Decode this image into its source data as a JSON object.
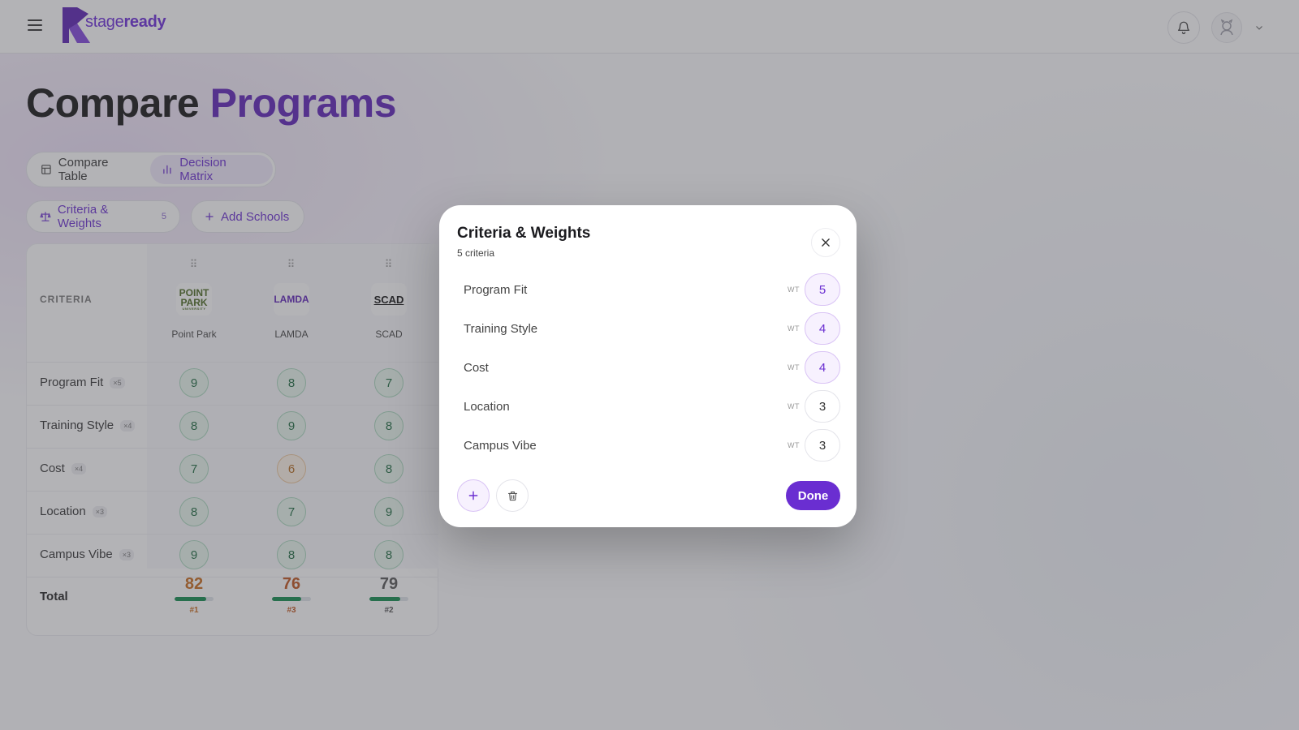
{
  "header": {
    "logo_text_thin": "stage",
    "logo_text_bold": "ready",
    "icons": [
      "menu-icon",
      "bell-icon",
      "avatar-icon",
      "chevron-down-icon"
    ]
  },
  "page": {
    "title_main": "Compare",
    "title_accent": "Programs"
  },
  "view_toggle": {
    "compare_table": "Compare Table",
    "decision_matrix": "Decision Matrix",
    "active": "Decision Matrix"
  },
  "toolbar": {
    "criteria_label": "Criteria & Weights",
    "criteria_count": "5",
    "add_schools_label": "Add Schools"
  },
  "matrix": {
    "header_label": "CRITERIA",
    "schools": [
      {
        "name": "Point Park",
        "logo_line1": "POINT",
        "logo_line2": "PARK",
        "logo_line3": "UNIVERSITY"
      },
      {
        "name": "LAMDA",
        "logo_text": "LAMDA"
      },
      {
        "name": "SCAD",
        "logo_text": "SCAD"
      }
    ],
    "rows": [
      {
        "label": "Program Fit",
        "weight": "×5",
        "scores": [
          "9",
          "8",
          "7"
        ]
      },
      {
        "label": "Training Style",
        "weight": "×4",
        "scores": [
          "8",
          "9",
          "8"
        ]
      },
      {
        "label": "Cost",
        "weight": "×4",
        "scores": [
          "7",
          "6",
          "8"
        ]
      },
      {
        "label": "Location",
        "weight": "×3",
        "scores": [
          "8",
          "7",
          "9"
        ]
      },
      {
        "label": "Campus Vibe",
        "weight": "×3",
        "scores": [
          "9",
          "8",
          "8"
        ]
      }
    ],
    "total_label": "Total",
    "totals": [
      {
        "value": "82",
        "rank": "#1",
        "fill": 0.82,
        "color": "#c86a1a"
      },
      {
        "value": "76",
        "rank": "#3",
        "fill": 0.76,
        "color": "#c0541c"
      },
      {
        "value": "79",
        "rank": "#2",
        "fill": 0.79,
        "color": "#555555"
      }
    ]
  },
  "modal": {
    "title": "Criteria & Weights",
    "subtitle": "5 criteria",
    "wt_label": "WT",
    "criteria": [
      {
        "name": "Program Fit",
        "weight": "5"
      },
      {
        "name": "Training Style",
        "weight": "4"
      },
      {
        "name": "Cost",
        "weight": "4"
      },
      {
        "name": "Location",
        "weight": "3"
      },
      {
        "name": "Campus Vibe",
        "weight": "3"
      }
    ],
    "done_label": "Done"
  },
  "colors": {
    "accent": "#6a2ed1",
    "score_good": "#1d6a3f",
    "score_mid": "#b46a1d"
  }
}
